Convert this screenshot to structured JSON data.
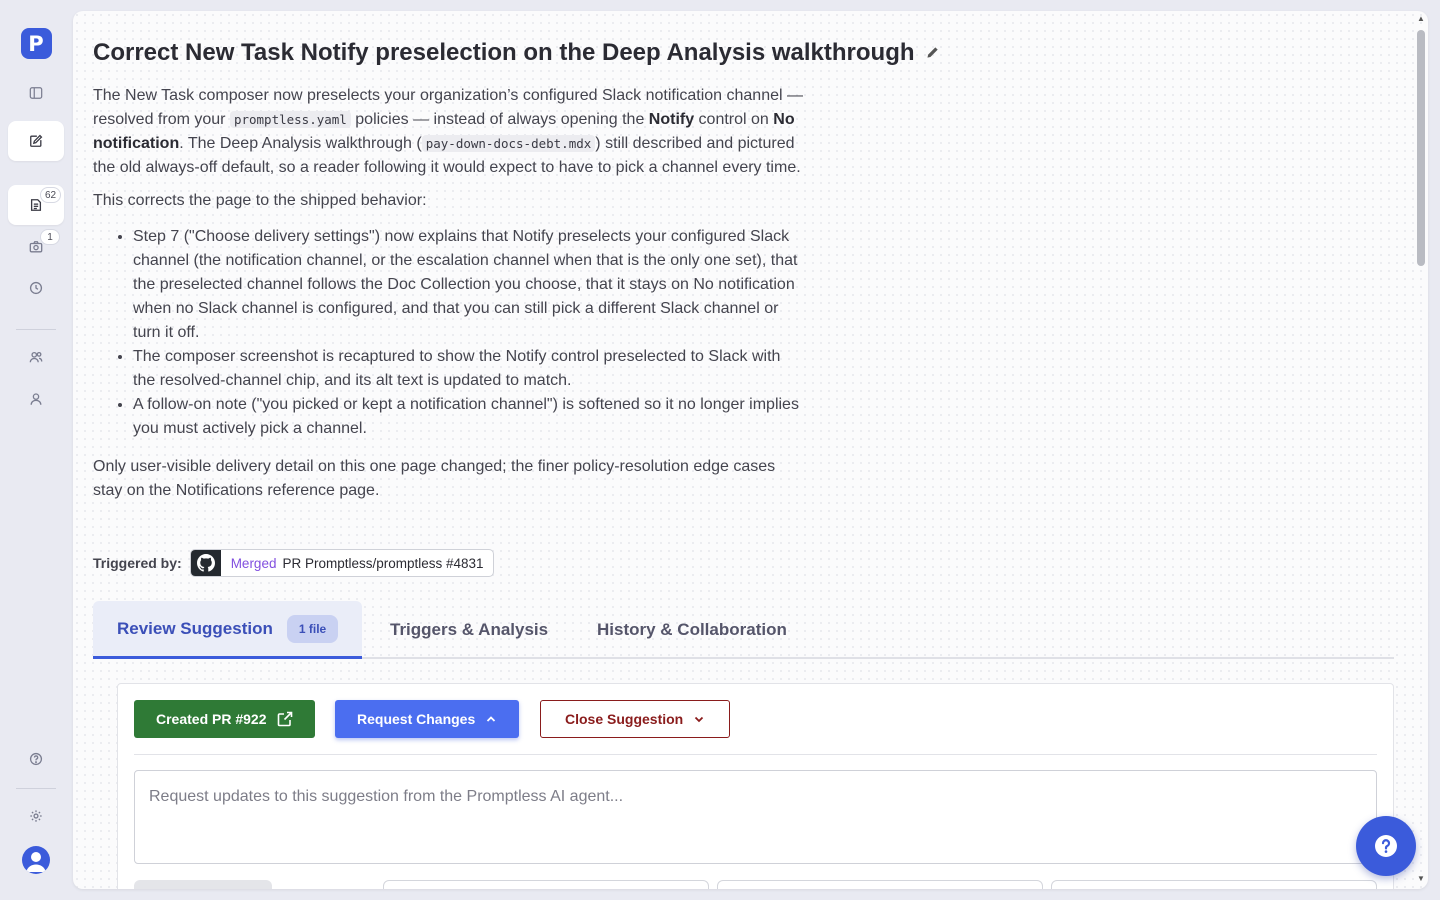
{
  "app": {
    "logo_letter": "P"
  },
  "sidebar": {
    "badges": {
      "suggestions": "62",
      "screenshots": "1"
    }
  },
  "suggestion": {
    "title": "Correct New Task Notify preselection on the Deep Analysis walkthrough",
    "p1": {
      "a": "The New Task composer now preselects your organization’s configured Slack notification channel — resolved from your ",
      "code1": "promptless.yaml",
      "b": " policies — instead of always opening the ",
      "bold1": "Notify",
      "c": " control on ",
      "bold2": "No notification",
      "d": ". The Deep Analysis walkthrough (",
      "code2": "pay-down-docs-debt.mdx",
      "e": ") still described and pictured the old always-off default, so a reader following it would expect to have to pick a channel every time."
    },
    "p2": "This corrects the page to the shipped behavior:",
    "bullets": [
      "Step 7 (\"Choose delivery settings\") now explains that Notify preselects your configured Slack channel (the notification channel, or the escalation channel when that is the only one set), that the preselected channel follows the Doc Collection you choose, that it stays on No notification when no Slack channel is configured, and that you can still pick a different Slack channel or turn it off.",
      "The composer screenshot is recaptured to show the Notify control preselected to Slack with the resolved-channel chip, and its alt text is updated to match.",
      "A follow-on note (\"you picked or kept a notification channel\") is softened so it no longer implies you must actively pick a channel."
    ],
    "p3": "Only user-visible delivery detail on this one page changed; the finer policy-resolution edge cases stay on the Notifications reference page."
  },
  "trigger": {
    "label": "Triggered by:",
    "status": "Merged",
    "pr_text": "PR Promptless/promptless #4831"
  },
  "tabs": {
    "review": "Review Suggestion",
    "review_count": "1 file",
    "triggers": "Triggers & Analysis",
    "history": "History & Collaboration"
  },
  "actions": {
    "created_pr": "Created PR #922",
    "request_changes": "Request Changes",
    "close_suggestion": "Close Suggestion",
    "request_placeholder": "Request updates to this suggestion from the Promptless AI agent..."
  },
  "colors": {
    "accent": "#3b5bdb",
    "pr_button": "#2f7a36",
    "close_button": "#8a1c1c",
    "merged": "#8250df"
  }
}
